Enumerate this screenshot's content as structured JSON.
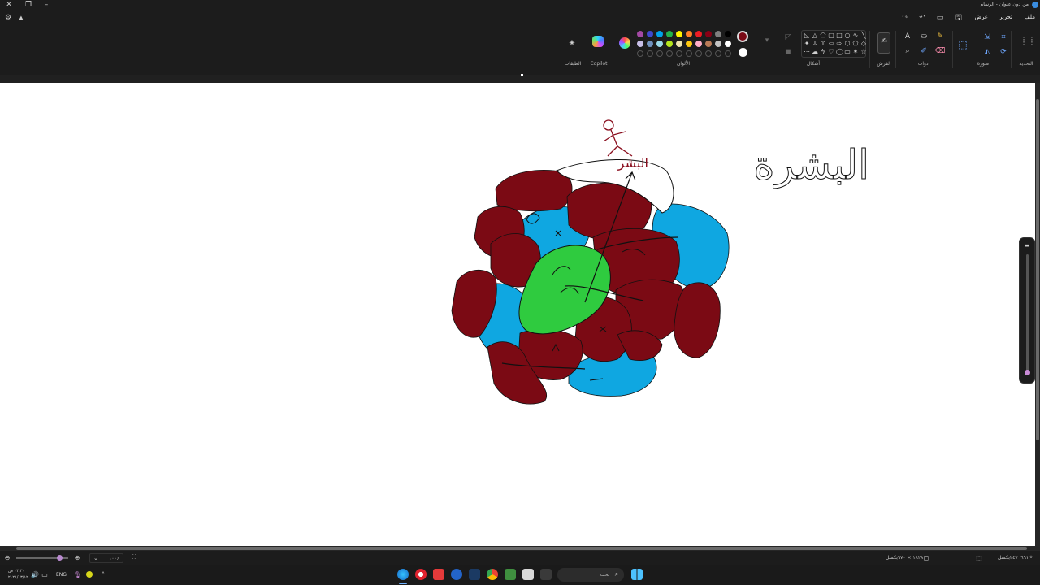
{
  "window": {
    "title": "من دون عنوان - الرسام"
  },
  "menu": {
    "file": "ملف",
    "edit": "تحرير",
    "view": "عرض"
  },
  "ribbon": {
    "groups": {
      "selection": "التحديد",
      "image": "صورة",
      "tools": "أدوات",
      "brushes": "الفرش",
      "shapes": "أشكال",
      "colors": "الألوان",
      "copilot": "Copilot",
      "layers": "الطبقات"
    },
    "palette": [
      "#000000",
      "#7f7f7f",
      "#880015",
      "#ed1c24",
      "#ff7f27",
      "#fff200",
      "#22b14c",
      "#00a2e8",
      "#3f48cc",
      "#a349a4",
      "#ffffff",
      "#c3c3c3",
      "#b97a57",
      "#ffaec9",
      "#ffc90e",
      "#efe4b0",
      "#b5e61d",
      "#99d9ea",
      "#7092be",
      "#c8bfe7"
    ],
    "active_color_1": "#7a0a16",
    "active_color_2": "#ffffff"
  },
  "drawing": {
    "heading": "البشرة",
    "label_top": "البشر",
    "colors": {
      "dark_red": "#7b0a14",
      "blue": "#0fa7e1",
      "green": "#2fcb3f",
      "outline": "#111111"
    }
  },
  "status": {
    "cursor": "٦٩١، ٢٤٧بكسل",
    "canvas_size": "١٨٢٨ × ٦٧٠بكسل",
    "zoom": "١٠٠٪"
  },
  "taskbar": {
    "search_placeholder": "بحث",
    "lang": "ENG",
    "time": "٠٣:٣٠ ص",
    "date": "٢٠٢٤/٠٣/١٢"
  }
}
